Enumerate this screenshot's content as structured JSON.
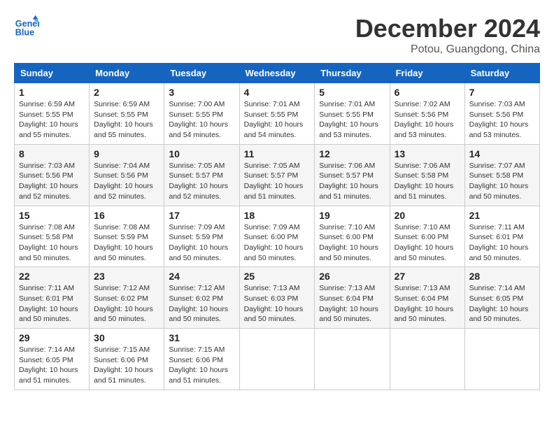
{
  "header": {
    "logo_line1": "General",
    "logo_line2": "Blue",
    "month_title": "December 2024",
    "subtitle": "Potou, Guangdong, China"
  },
  "weekdays": [
    "Sunday",
    "Monday",
    "Tuesday",
    "Wednesday",
    "Thursday",
    "Friday",
    "Saturday"
  ],
  "weeks": [
    [
      {
        "day": "1",
        "sunrise": "6:59 AM",
        "sunset": "5:55 PM",
        "daylight": "10 hours and 55 minutes."
      },
      {
        "day": "2",
        "sunrise": "6:59 AM",
        "sunset": "5:55 PM",
        "daylight": "10 hours and 55 minutes."
      },
      {
        "day": "3",
        "sunrise": "7:00 AM",
        "sunset": "5:55 PM",
        "daylight": "10 hours and 54 minutes."
      },
      {
        "day": "4",
        "sunrise": "7:01 AM",
        "sunset": "5:55 PM",
        "daylight": "10 hours and 54 minutes."
      },
      {
        "day": "5",
        "sunrise": "7:01 AM",
        "sunset": "5:55 PM",
        "daylight": "10 hours and 53 minutes."
      },
      {
        "day": "6",
        "sunrise": "7:02 AM",
        "sunset": "5:56 PM",
        "daylight": "10 hours and 53 minutes."
      },
      {
        "day": "7",
        "sunrise": "7:03 AM",
        "sunset": "5:56 PM",
        "daylight": "10 hours and 53 minutes."
      }
    ],
    [
      {
        "day": "8",
        "sunrise": "7:03 AM",
        "sunset": "5:56 PM",
        "daylight": "10 hours and 52 minutes."
      },
      {
        "day": "9",
        "sunrise": "7:04 AM",
        "sunset": "5:56 PM",
        "daylight": "10 hours and 52 minutes."
      },
      {
        "day": "10",
        "sunrise": "7:05 AM",
        "sunset": "5:57 PM",
        "daylight": "10 hours and 52 minutes."
      },
      {
        "day": "11",
        "sunrise": "7:05 AM",
        "sunset": "5:57 PM",
        "daylight": "10 hours and 51 minutes."
      },
      {
        "day": "12",
        "sunrise": "7:06 AM",
        "sunset": "5:57 PM",
        "daylight": "10 hours and 51 minutes."
      },
      {
        "day": "13",
        "sunrise": "7:06 AM",
        "sunset": "5:58 PM",
        "daylight": "10 hours and 51 minutes."
      },
      {
        "day": "14",
        "sunrise": "7:07 AM",
        "sunset": "5:58 PM",
        "daylight": "10 hours and 50 minutes."
      }
    ],
    [
      {
        "day": "15",
        "sunrise": "7:08 AM",
        "sunset": "5:58 PM",
        "daylight": "10 hours and 50 minutes."
      },
      {
        "day": "16",
        "sunrise": "7:08 AM",
        "sunset": "5:59 PM",
        "daylight": "10 hours and 50 minutes."
      },
      {
        "day": "17",
        "sunrise": "7:09 AM",
        "sunset": "5:59 PM",
        "daylight": "10 hours and 50 minutes."
      },
      {
        "day": "18",
        "sunrise": "7:09 AM",
        "sunset": "6:00 PM",
        "daylight": "10 hours and 50 minutes."
      },
      {
        "day": "19",
        "sunrise": "7:10 AM",
        "sunset": "6:00 PM",
        "daylight": "10 hours and 50 minutes."
      },
      {
        "day": "20",
        "sunrise": "7:10 AM",
        "sunset": "6:00 PM",
        "daylight": "10 hours and 50 minutes."
      },
      {
        "day": "21",
        "sunrise": "7:11 AM",
        "sunset": "6:01 PM",
        "daylight": "10 hours and 50 minutes."
      }
    ],
    [
      {
        "day": "22",
        "sunrise": "7:11 AM",
        "sunset": "6:01 PM",
        "daylight": "10 hours and 50 minutes."
      },
      {
        "day": "23",
        "sunrise": "7:12 AM",
        "sunset": "6:02 PM",
        "daylight": "10 hours and 50 minutes."
      },
      {
        "day": "24",
        "sunrise": "7:12 AM",
        "sunset": "6:02 PM",
        "daylight": "10 hours and 50 minutes."
      },
      {
        "day": "25",
        "sunrise": "7:13 AM",
        "sunset": "6:03 PM",
        "daylight": "10 hours and 50 minutes."
      },
      {
        "day": "26",
        "sunrise": "7:13 AM",
        "sunset": "6:04 PM",
        "daylight": "10 hours and 50 minutes."
      },
      {
        "day": "27",
        "sunrise": "7:13 AM",
        "sunset": "6:04 PM",
        "daylight": "10 hours and 50 minutes."
      },
      {
        "day": "28",
        "sunrise": "7:14 AM",
        "sunset": "6:05 PM",
        "daylight": "10 hours and 50 minutes."
      }
    ],
    [
      {
        "day": "29",
        "sunrise": "7:14 AM",
        "sunset": "6:05 PM",
        "daylight": "10 hours and 51 minutes."
      },
      {
        "day": "30",
        "sunrise": "7:15 AM",
        "sunset": "6:06 PM",
        "daylight": "10 hours and 51 minutes."
      },
      {
        "day": "31",
        "sunrise": "7:15 AM",
        "sunset": "6:06 PM",
        "daylight": "10 hours and 51 minutes."
      },
      null,
      null,
      null,
      null
    ]
  ],
  "labels": {
    "sunrise": "Sunrise:",
    "sunset": "Sunset:",
    "daylight": "Daylight:"
  }
}
